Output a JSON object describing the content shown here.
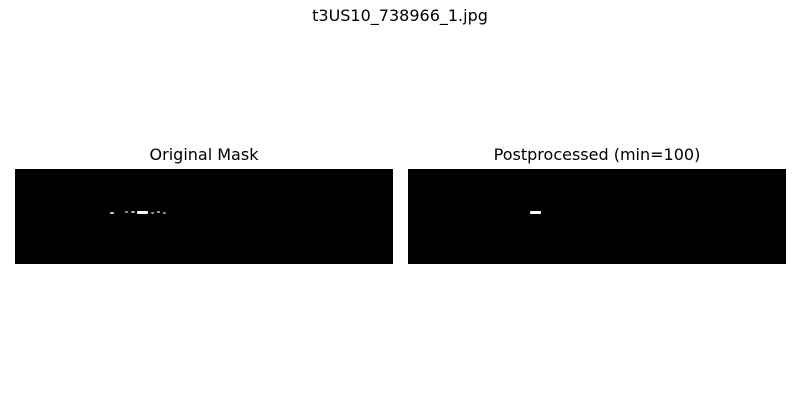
{
  "figure": {
    "title": "t3US10_738966_1.jpg"
  },
  "panels": [
    {
      "title": "Original Mask",
      "mask_color": "#000000",
      "foreground_color": "#ffffff"
    },
    {
      "title": "Postprocessed (min=100)",
      "mask_color": "#000000",
      "foreground_color": "#ffffff"
    }
  ]
}
